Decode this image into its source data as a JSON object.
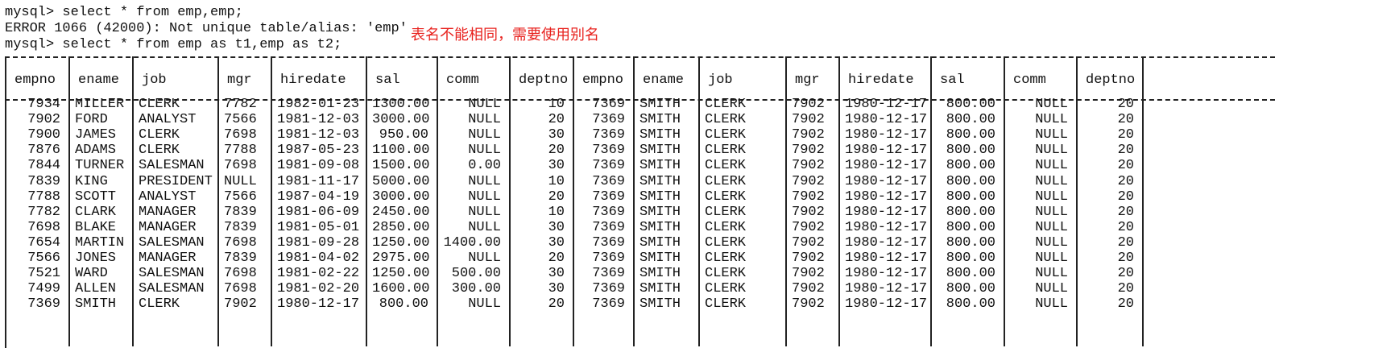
{
  "console": {
    "line1": "mysql> select * from emp,emp;",
    "line2": "ERROR 1066 (42000): Not unique table/alias: 'emp'",
    "line3": "mysql> select * from emp as t1,emp as t2;",
    "note": "表名不能相同，需要使用别名"
  },
  "table": {
    "headers": [
      "empno",
      "ename",
      "job",
      "mgr",
      "hiredate",
      "sal",
      "comm",
      "deptno",
      "empno",
      "ename",
      "job",
      "mgr",
      "hiredate",
      "sal",
      "comm",
      "deptno"
    ],
    "rows": [
      [
        "7934",
        "MILLER",
        "CLERK",
        "7782",
        "1982-01-23",
        "1300.00",
        "NULL",
        "10",
        "7369",
        "SMITH",
        "CLERK",
        "7902",
        "1980-12-17",
        "800.00",
        "NULL",
        "20"
      ],
      [
        "7902",
        "FORD",
        "ANALYST",
        "7566",
        "1981-12-03",
        "3000.00",
        "NULL",
        "20",
        "7369",
        "SMITH",
        "CLERK",
        "7902",
        "1980-12-17",
        "800.00",
        "NULL",
        "20"
      ],
      [
        "7900",
        "JAMES",
        "CLERK",
        "7698",
        "1981-12-03",
        "950.00",
        "NULL",
        "30",
        "7369",
        "SMITH",
        "CLERK",
        "7902",
        "1980-12-17",
        "800.00",
        "NULL",
        "20"
      ],
      [
        "7876",
        "ADAMS",
        "CLERK",
        "7788",
        "1987-05-23",
        "1100.00",
        "NULL",
        "20",
        "7369",
        "SMITH",
        "CLERK",
        "7902",
        "1980-12-17",
        "800.00",
        "NULL",
        "20"
      ],
      [
        "7844",
        "TURNER",
        "SALESMAN",
        "7698",
        "1981-09-08",
        "1500.00",
        "0.00",
        "30",
        "7369",
        "SMITH",
        "CLERK",
        "7902",
        "1980-12-17",
        "800.00",
        "NULL",
        "20"
      ],
      [
        "7839",
        "KING",
        "PRESIDENT",
        "NULL",
        "1981-11-17",
        "5000.00",
        "NULL",
        "10",
        "7369",
        "SMITH",
        "CLERK",
        "7902",
        "1980-12-17",
        "800.00",
        "NULL",
        "20"
      ],
      [
        "7788",
        "SCOTT",
        "ANALYST",
        "7566",
        "1987-04-19",
        "3000.00",
        "NULL",
        "20",
        "7369",
        "SMITH",
        "CLERK",
        "7902",
        "1980-12-17",
        "800.00",
        "NULL",
        "20"
      ],
      [
        "7782",
        "CLARK",
        "MANAGER",
        "7839",
        "1981-06-09",
        "2450.00",
        "NULL",
        "10",
        "7369",
        "SMITH",
        "CLERK",
        "7902",
        "1980-12-17",
        "800.00",
        "NULL",
        "20"
      ],
      [
        "7698",
        "BLAKE",
        "MANAGER",
        "7839",
        "1981-05-01",
        "2850.00",
        "NULL",
        "30",
        "7369",
        "SMITH",
        "CLERK",
        "7902",
        "1980-12-17",
        "800.00",
        "NULL",
        "20"
      ],
      [
        "7654",
        "MARTIN",
        "SALESMAN",
        "7698",
        "1981-09-28",
        "1250.00",
        "1400.00",
        "30",
        "7369",
        "SMITH",
        "CLERK",
        "7902",
        "1980-12-17",
        "800.00",
        "NULL",
        "20"
      ],
      [
        "7566",
        "JONES",
        "MANAGER",
        "7839",
        "1981-04-02",
        "2975.00",
        "NULL",
        "20",
        "7369",
        "SMITH",
        "CLERK",
        "7902",
        "1980-12-17",
        "800.00",
        "NULL",
        "20"
      ],
      [
        "7521",
        "WARD",
        "SALESMAN",
        "7698",
        "1981-02-22",
        "1250.00",
        "500.00",
        "30",
        "7369",
        "SMITH",
        "CLERK",
        "7902",
        "1980-12-17",
        "800.00",
        "NULL",
        "20"
      ],
      [
        "7499",
        "ALLEN",
        "SALESMAN",
        "7698",
        "1981-02-20",
        "1600.00",
        "300.00",
        "30",
        "7369",
        "SMITH",
        "CLERK",
        "7902",
        "1980-12-17",
        "800.00",
        "NULL",
        "20"
      ],
      [
        "7369",
        "SMITH",
        "CLERK",
        "7902",
        "1980-12-17",
        "800.00",
        "NULL",
        "20",
        "7369",
        "SMITH",
        "CLERK",
        "7902",
        "1980-12-17",
        "800.00",
        "NULL",
        "20"
      ]
    ]
  }
}
